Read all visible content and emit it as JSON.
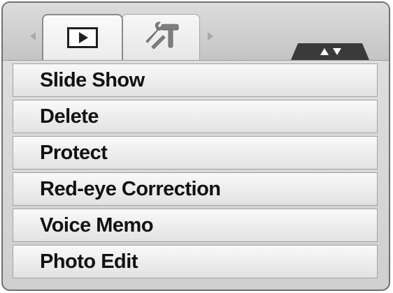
{
  "header": {
    "tabs": [
      {
        "id": "playback",
        "icon": "play-icon",
        "active": true
      },
      {
        "id": "setup",
        "icon": "tools-icon",
        "active": false
      }
    ],
    "scroll_icon": "up-down-arrows-icon"
  },
  "menu": {
    "items": [
      {
        "label": "Slide Show"
      },
      {
        "label": "Delete"
      },
      {
        "label": "Protect"
      },
      {
        "label": "Red-eye Correction"
      },
      {
        "label": "Voice Memo"
      },
      {
        "label": "Photo Edit"
      }
    ]
  },
  "colors": {
    "screen_background": "#d6d6d6",
    "active_tab": "#f4f4f4",
    "scroll_tab": "#3a3a3a",
    "menu_text": "#111111"
  }
}
